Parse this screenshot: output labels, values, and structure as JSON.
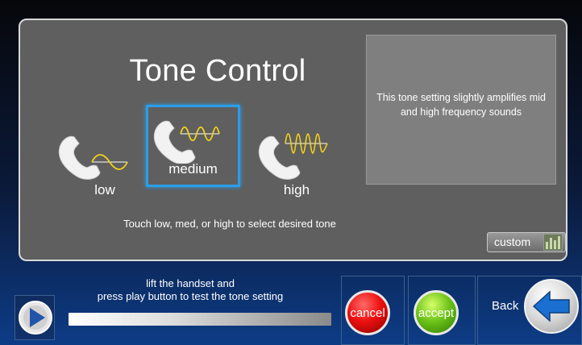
{
  "screen": {
    "title": "Tone Control",
    "instruction": "Touch low, med, or high to select desired tone"
  },
  "tones": [
    {
      "label": "low",
      "selected": false,
      "icon": "handset-low-wave-icon"
    },
    {
      "label": "medium",
      "selected": true,
      "icon": "handset-medium-wave-icon"
    },
    {
      "label": "high",
      "selected": false,
      "icon": "handset-high-wave-icon"
    }
  ],
  "description": {
    "text": "This tone setting slightly amplifies mid and high frequency sounds"
  },
  "custom": {
    "label": "custom",
    "icon": "equalizer-icon"
  },
  "test": {
    "instruction_line1": "lift the handset and",
    "instruction_line2": "press play button to test the tone setting",
    "progress": 0
  },
  "actions": {
    "cancel_label": "cancel",
    "accept_label": "accept",
    "back_label": "Back"
  },
  "colors": {
    "panel": "#5f5f5f",
    "selected_border": "#2a9ee8",
    "wave": "#f2d21a",
    "cancel": "#e11111",
    "accept": "#6fc41a",
    "back_arrow": "#1a6fd0"
  }
}
